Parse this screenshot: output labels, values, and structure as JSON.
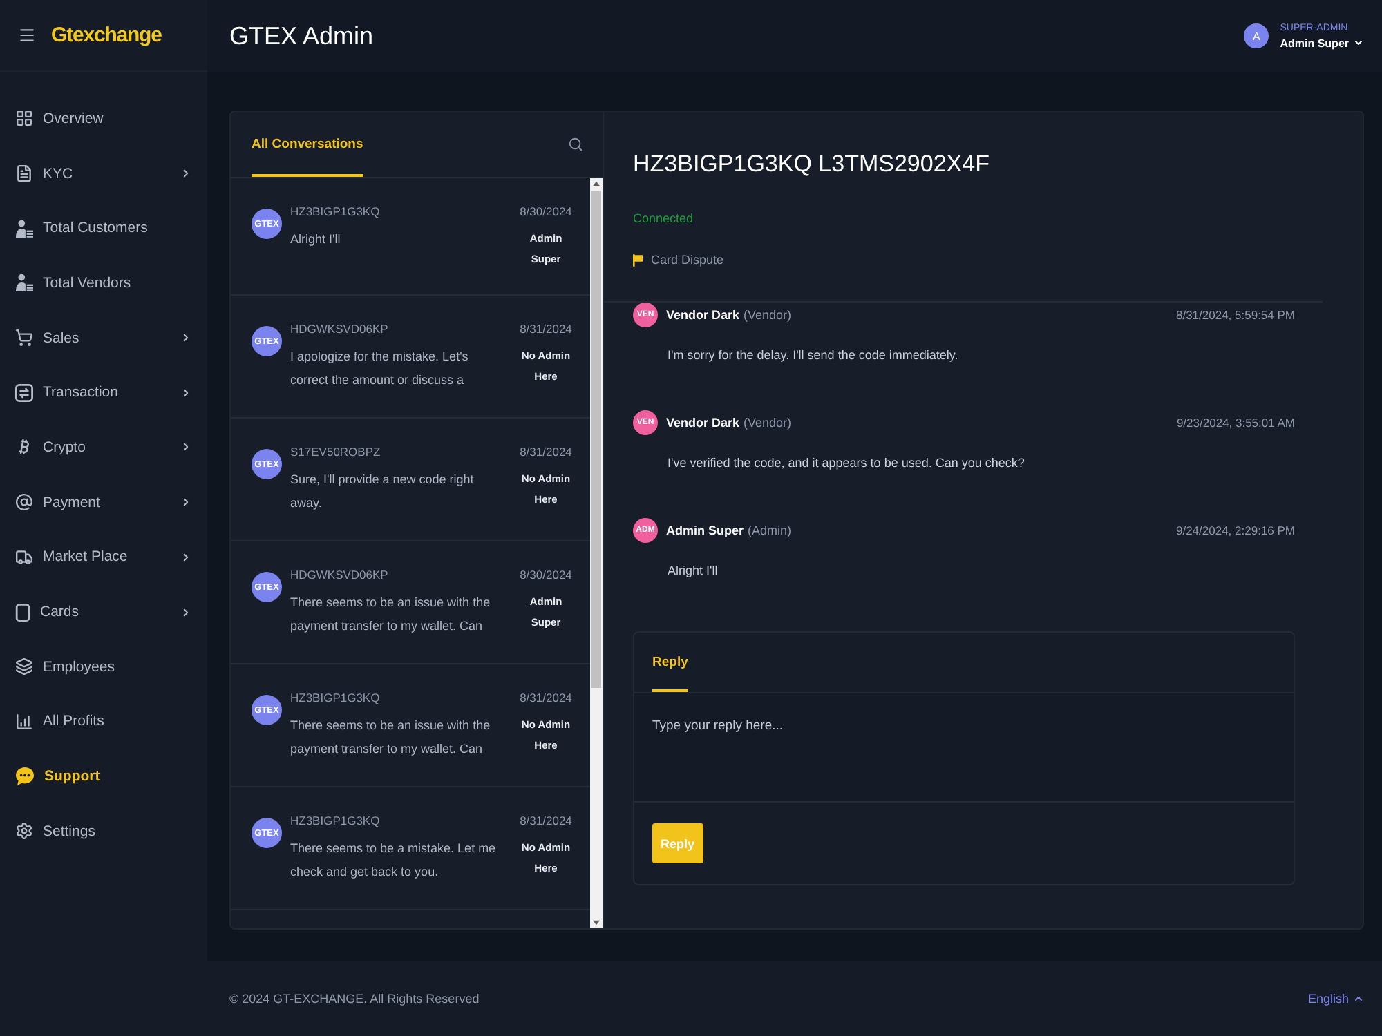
{
  "sidebar": {
    "logo": "Gtexchange",
    "items": [
      {
        "label": "Overview",
        "kind": "link",
        "selected": false
      },
      {
        "label": "KYC",
        "kind": "submenu",
        "selected": false
      },
      {
        "label": "Total Customers",
        "kind": "link",
        "selected": false
      },
      {
        "label": "Total Vendors",
        "kind": "link",
        "selected": false
      },
      {
        "label": "Sales",
        "kind": "submenu",
        "selected": false
      },
      {
        "label": "Transaction",
        "kind": "submenu",
        "selected": false
      },
      {
        "label": "Crypto",
        "kind": "submenu",
        "selected": false
      },
      {
        "label": "Payment",
        "kind": "submenu",
        "selected": false
      },
      {
        "label": "Market Place",
        "kind": "submenu",
        "selected": false
      },
      {
        "label": "Cards",
        "kind": "submenu",
        "selected": false
      },
      {
        "label": "Employees",
        "kind": "link",
        "selected": false
      },
      {
        "label": "All Profits",
        "kind": "link",
        "selected": false
      },
      {
        "label": "Support",
        "kind": "link",
        "selected": true
      },
      {
        "label": "Settings",
        "kind": "link",
        "selected": false
      }
    ]
  },
  "header": {
    "title": "GTEX Admin",
    "user": {
      "initial": "A",
      "role": "SUPER-ADMIN",
      "name": "Admin Super"
    }
  },
  "conversations": {
    "tabs": [
      {
        "label": "All Conversations",
        "selected": true
      }
    ],
    "items": [
      {
        "avatar": "GTEX",
        "ticket": "HZ3BIGP1G3KQ",
        "date": "8/30/2024",
        "preview": "Alright I'll",
        "assignee": "Admin Super"
      },
      {
        "avatar": "GTEX",
        "ticket": "HDGWKSVD06KP",
        "date": "8/31/2024",
        "preview": "I apologize for the mistake. Let's correct the amount or discuss a",
        "assignee": "No Admin Here"
      },
      {
        "avatar": "GTEX",
        "ticket": "S17EV50ROBPZ",
        "date": "8/31/2024",
        "preview": "Sure, I'll provide a new code right away.",
        "assignee": "No Admin Here"
      },
      {
        "avatar": "GTEX",
        "ticket": "HDGWKSVD06KP",
        "date": "8/30/2024",
        "preview": "There seems to be an issue with the payment transfer to my wallet. Can",
        "assignee": "Admin Super"
      },
      {
        "avatar": "GTEX",
        "ticket": "HZ3BIGP1G3KQ",
        "date": "8/31/2024",
        "preview": "There seems to be an issue with the payment transfer to my wallet. Can",
        "assignee": "No Admin Here"
      },
      {
        "avatar": "GTEX",
        "ticket": "HZ3BIGP1G3KQ",
        "date": "8/31/2024",
        "preview": "There seems to be a mistake. Let me check and get back to you.",
        "assignee": "No Admin Here"
      }
    ]
  },
  "chat": {
    "title": "HZ3BIGP1G3KQ L3TMS2902X4F",
    "status": "Connected",
    "category": "Card Dispute",
    "messages": [
      {
        "avatar": "VEN",
        "sender": "Vendor Dark",
        "role": "(Vendor)",
        "time": "8/31/2024, 5:59:54 PM",
        "text": "I'm sorry for the delay. I'll send the code immediately."
      },
      {
        "avatar": "VEN",
        "sender": "Vendor Dark",
        "role": "(Vendor)",
        "time": "9/23/2024, 3:55:01 AM",
        "text": "I've verified the code, and it appears to be used. Can you check?"
      },
      {
        "avatar": "ADM",
        "sender": "Admin Super",
        "role": "(Admin)",
        "time": "9/24/2024, 2:29:16 PM",
        "text": "Alright I'll"
      }
    ]
  },
  "reply_box": {
    "tabs": [
      {
        "label": "Reply",
        "selected": true
      }
    ],
    "placeholder": "Type your reply here...",
    "button": "Reply"
  },
  "footer": {
    "copyright": "© 2024 GT-EXCHANGE. All Rights Reserved",
    "language": "English"
  }
}
